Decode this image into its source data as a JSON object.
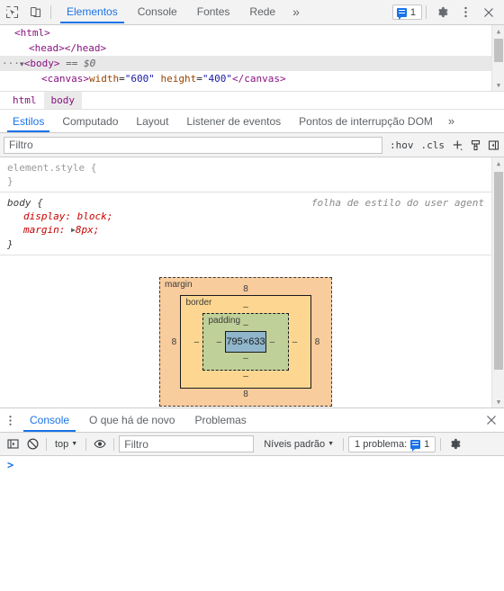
{
  "main_toolbar": {
    "inspect_icon": "inspect-element-icon",
    "device_icon": "device-toolbar-icon",
    "tabs": [
      {
        "label": "Elementos",
        "active": true
      },
      {
        "label": "Console",
        "active": false
      },
      {
        "label": "Fontes",
        "active": false
      },
      {
        "label": "Rede",
        "active": false
      }
    ],
    "more_tabs_label": "»",
    "issues_count": "1",
    "issues_icon": "issue-message-icon",
    "settings_icon": "gear-icon",
    "more_options_icon": "kebab-menu-icon",
    "close_icon": "close-icon"
  },
  "dom_tree": {
    "lines": [
      {
        "text": "<html>",
        "indent": 1,
        "selected": false
      },
      {
        "text": "<head></head>",
        "indent": 2,
        "selected": false
      },
      {
        "text": "<body> == $0",
        "indent": 0,
        "selected": true
      },
      {
        "text": "<canvas>width=\"600\" height=\"400\"</canvas>",
        "indent": 3,
        "selected": false
      }
    ],
    "body_line": {
      "dots": "···",
      "twisty": "▼",
      "tag_open": "<body>",
      "ref": "== $0"
    },
    "canvas_line": {
      "tag_open": "<canvas>",
      "attr1_name": "width",
      "attr1_value": "\"600\"",
      "attr2_name": "height",
      "attr2_value": "\"400\"",
      "tag_close": "</canvas>"
    },
    "html_line": "<html>",
    "head_line": "<head></head>"
  },
  "breadcrumb": {
    "items": [
      {
        "label": "html",
        "selected": false
      },
      {
        "label": "body",
        "selected": true
      }
    ]
  },
  "sidebar_tabs": {
    "tabs": [
      {
        "label": "Estilos",
        "active": true
      },
      {
        "label": "Computado",
        "active": false
      },
      {
        "label": "Layout",
        "active": false
      },
      {
        "label": "Listener de eventos",
        "active": false
      },
      {
        "label": "Pontos de interrupção DOM",
        "active": false
      }
    ],
    "more_label": "»"
  },
  "styles_filter": {
    "placeholder": "Filtro",
    "value": "",
    "hov_label": ":hov",
    "cls_label": ".cls",
    "new_rule_icon": "plus-icon",
    "classes_icon": "new-style-rule-icon",
    "toggle_icon": "toggle-sidebar-icon"
  },
  "styles_rules": [
    {
      "selector": "element.style",
      "selector_style": "gray",
      "origin": "",
      "open_brace": "{",
      "close_brace": "}",
      "properties": []
    },
    {
      "selector": "body",
      "selector_style": "normal",
      "origin": "folha de estilo do user agent",
      "open_brace": "{",
      "close_brace": "}",
      "properties": [
        {
          "name": "display",
          "value": "block",
          "expandable": false
        },
        {
          "name": "margin",
          "value": "8px",
          "expandable": true
        }
      ]
    }
  ],
  "box_model": {
    "margin_label": "margin",
    "margin_top": "8",
    "margin_right": "8",
    "margin_bottom": "8",
    "margin_left": "8",
    "border_label": "border",
    "border_top": "–",
    "border_right": "–",
    "border_bottom": "–",
    "border_left": "–",
    "padding_label": "padding",
    "padding_top": "–",
    "padding_right": "–",
    "padding_bottom": "–",
    "padding_left": "–",
    "content_size": "795×633",
    "colors": {
      "margin": "#f9cc9d",
      "border": "#fdd791",
      "padding": "#c0d099",
      "content": "#90b6cb"
    }
  },
  "drawer": {
    "menu_icon": "kebab-menu-icon",
    "tabs": [
      {
        "label": "Console",
        "active": true
      },
      {
        "label": "O que há de novo",
        "active": false
      },
      {
        "label": "Problemas",
        "active": false
      }
    ],
    "close_icon": "close-icon"
  },
  "console_toolbar": {
    "sidebar_icon": "console-sidebar-icon",
    "clear_icon": "clear-console-icon",
    "context_label": "top",
    "context_caret": "▼",
    "eye_icon": "live-expression-icon",
    "filter_placeholder": "Filtro",
    "filter_value": "",
    "levels_label": "Níveis padrão",
    "levels_caret": "▼",
    "problems_label": "1 problema:",
    "problems_count": "1",
    "problems_icon": "issue-message-icon",
    "settings_icon": "gear-icon"
  },
  "console_body": {
    "prompt": ">"
  },
  "theme": {
    "accent": "#1a73e8",
    "toolbar_bg": "#f3f3f3",
    "border": "#cdcdcd",
    "text": "#5f6368",
    "tag_color": "#881280",
    "attr_name_color": "#994500",
    "attr_value_color": "#1a1aa6",
    "prop_color": "#c80000"
  }
}
